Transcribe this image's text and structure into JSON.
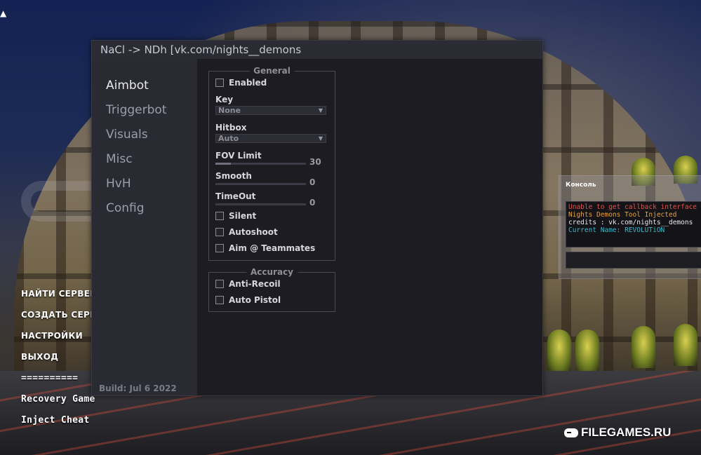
{
  "window": {
    "title": "NaCl -> NDh [vk.com/nights__demons",
    "build": "Build: Jul  6 2022"
  },
  "sidebar": {
    "items": [
      {
        "label": "Aimbot",
        "active": true
      },
      {
        "label": "Triggerbot",
        "active": false
      },
      {
        "label": "Visuals",
        "active": false
      },
      {
        "label": "Misc",
        "active": false
      },
      {
        "label": "HvH",
        "active": false
      },
      {
        "label": "Config",
        "active": false
      }
    ]
  },
  "general": {
    "title": "General",
    "enabled": {
      "label": "Enabled",
      "checked": false
    },
    "key": {
      "label": "Key",
      "value": "None"
    },
    "hitbox": {
      "label": "Hitbox",
      "value": "Auto"
    },
    "fov_limit": {
      "label": "FOV Limit",
      "value": "30",
      "fraction": 0.17
    },
    "smooth": {
      "label": "Smooth",
      "value": "0",
      "fraction": 0
    },
    "timeout": {
      "label": "TimeOut",
      "value": "0",
      "fraction": 0
    },
    "silent": {
      "label": "Silent",
      "checked": false
    },
    "autoshoot": {
      "label": "Autoshoot",
      "checked": false
    },
    "aim_teammates": {
      "label": "Aim @ Teammates",
      "checked": false
    }
  },
  "accuracy": {
    "title": "Accuracy",
    "anti_recoil": {
      "label": "Anti-Recoil",
      "checked": false
    },
    "auto_pistol": {
      "label": "Auto Pistol",
      "checked": false
    }
  },
  "console": {
    "title": "Консоль",
    "lines": [
      {
        "text": "Unable to get callback interface",
        "color": "#e0554a"
      },
      {
        "text": "Nights Demons Tool Injected",
        "color": "#e6a23a"
      },
      {
        "text": "credits : vk.com/nights__demons",
        "color": "#e9e9ec"
      },
      {
        "text": "Current Name: REVOLUTiON",
        "color": "#38b7c9"
      }
    ]
  },
  "main_menu": {
    "items": [
      "НАЙТИ СЕРВЕР",
      "СОЗДАТЬ СЕРВЕР",
      "НАСТРОЙКИ",
      "ВЫХОД",
      "==========",
      "Recovery Game",
      "Inject Cheat"
    ]
  },
  "watermark": "FILEGAMES.RU",
  "colors": {
    "window_bg": "#1f1f25",
    "sidebar_bg": "#2a2a32",
    "accent_text": "#e8e8ee"
  }
}
